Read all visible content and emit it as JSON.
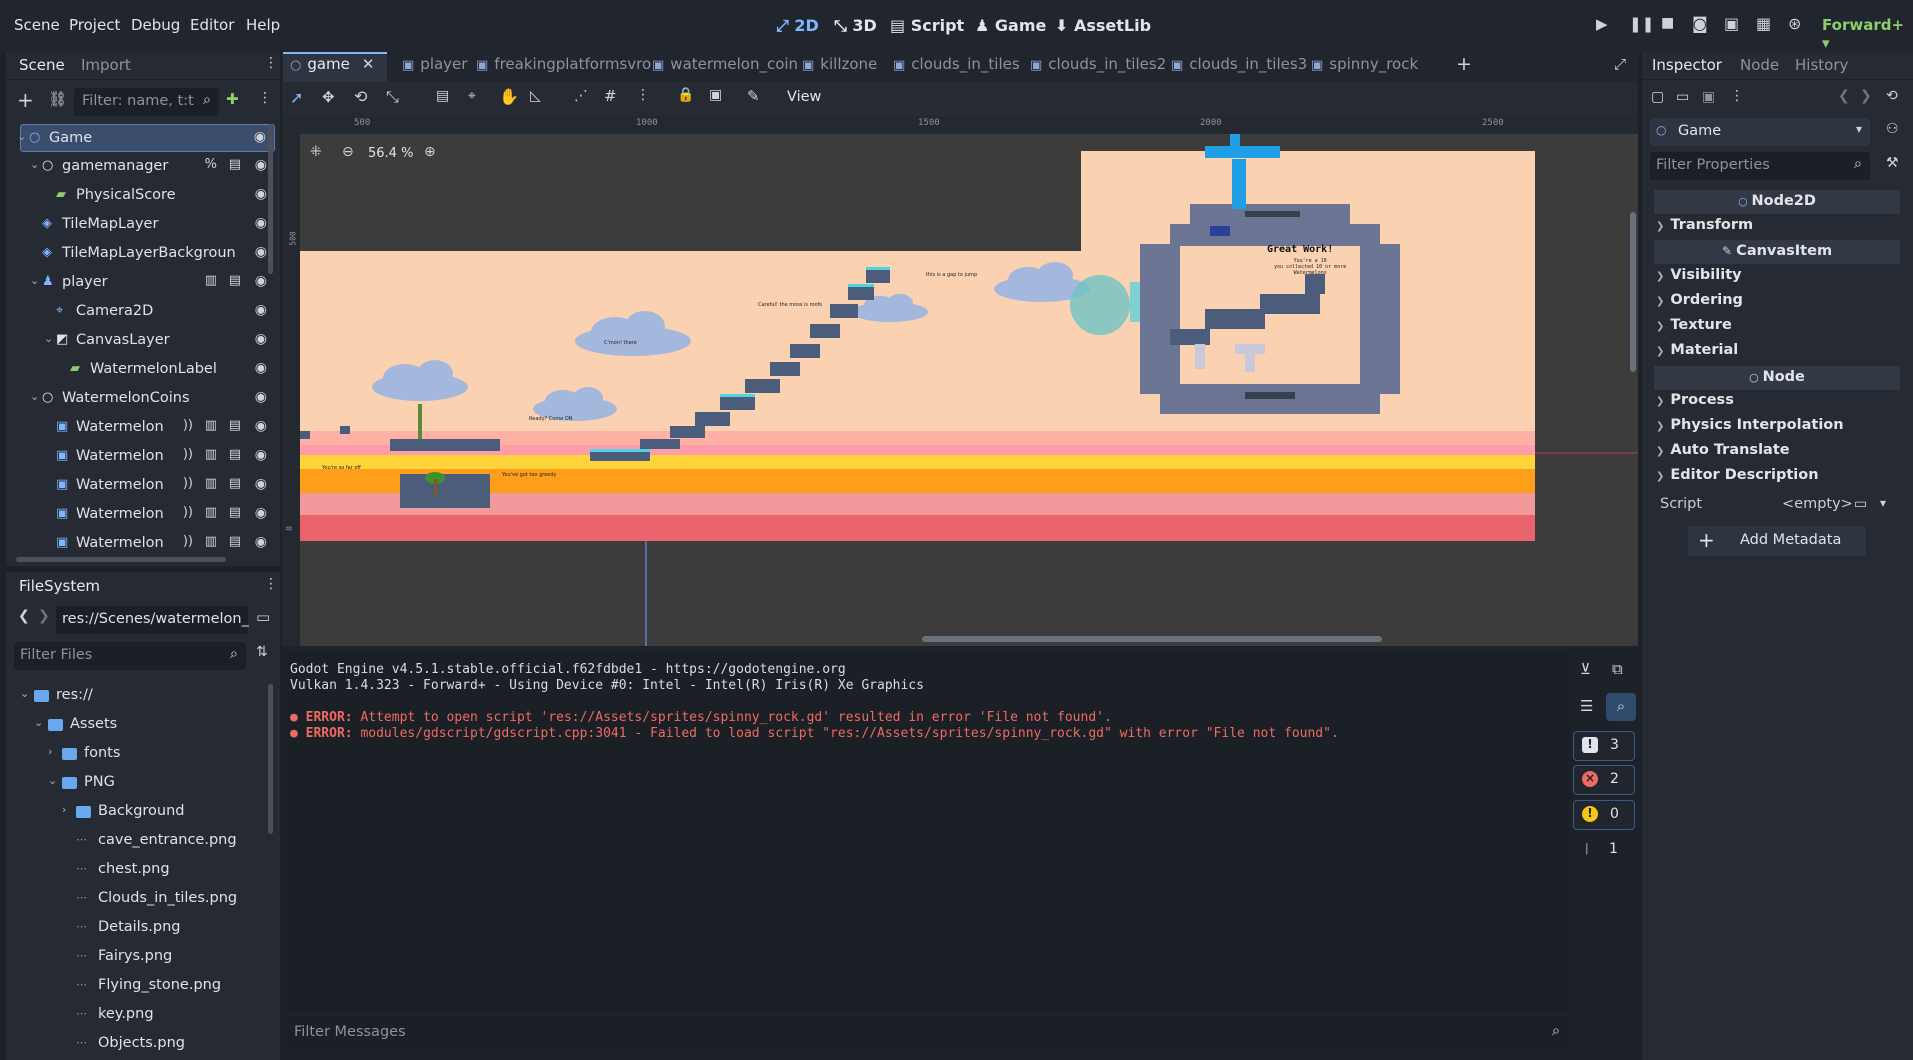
{
  "menu": [
    "Scene",
    "Project",
    "Debug",
    "Editor",
    "Help"
  ],
  "workspaces": [
    {
      "label": "2D",
      "icon": "2d-icon",
      "active": true
    },
    {
      "label": "3D",
      "icon": "3d-icon",
      "active": false
    },
    {
      "label": "Script",
      "icon": "script-icon",
      "active": false
    },
    {
      "label": "Game",
      "icon": "game-icon",
      "active": false
    },
    {
      "label": "AssetLib",
      "icon": "assetlib-icon",
      "active": false
    }
  ],
  "renderer": "Forward+",
  "scene_panel": {
    "tabs": [
      "Scene",
      "Import"
    ],
    "filter_placeholder": "Filter: name, t:t",
    "nodes": [
      {
        "label": "Game",
        "icon": "node2d-icon",
        "depth": 0,
        "expanded": true,
        "selected": true
      },
      {
        "label": "gamemanager",
        "icon": "node-icon",
        "depth": 1,
        "expanded": true,
        "extra": [
          "%",
          "script"
        ]
      },
      {
        "label": "PhysicalScore",
        "icon": "label-icon",
        "depth": 2
      },
      {
        "label": "TileMapLayer",
        "icon": "tilemap-icon",
        "depth": 1
      },
      {
        "label": "TileMapLayerBackgroun",
        "icon": "tilemap-icon",
        "depth": 1
      },
      {
        "label": "player",
        "icon": "player-icon",
        "depth": 1,
        "expanded": true,
        "extra": [
          "clapper",
          "script"
        ]
      },
      {
        "label": "Camera2D",
        "icon": "camera-icon",
        "depth": 2
      },
      {
        "label": "CanvasLayer",
        "icon": "canvaslayer-icon",
        "depth": 2,
        "expanded": true
      },
      {
        "label": "WatermelonLabel",
        "icon": "label-icon",
        "depth": 3
      },
      {
        "label": "WatermelonCoins",
        "icon": "node-icon",
        "depth": 1,
        "expanded": true
      },
      {
        "label": "Watermelon",
        "icon": "area-icon",
        "depth": 2,
        "extra": [
          "signal",
          "clapper",
          "script"
        ]
      },
      {
        "label": "Watermelon",
        "icon": "area-icon",
        "depth": 2,
        "extra": [
          "signal",
          "clapper",
          "script"
        ]
      },
      {
        "label": "Watermelon",
        "icon": "area-icon",
        "depth": 2,
        "extra": [
          "signal",
          "clapper",
          "script"
        ]
      },
      {
        "label": "Watermelon",
        "icon": "area-icon",
        "depth": 2,
        "extra": [
          "signal",
          "clapper",
          "script"
        ]
      },
      {
        "label": "Watermelon",
        "icon": "area-icon",
        "depth": 2,
        "extra": [
          "signal",
          "clapper",
          "script"
        ]
      }
    ]
  },
  "filesystem": {
    "title": "FileSystem",
    "path": "res://Scenes/watermelon_",
    "filter_placeholder": "Filter Files",
    "items": [
      {
        "label": "res://",
        "type": "folder",
        "depth": 0,
        "expanded": true
      },
      {
        "label": "Assets",
        "type": "folder",
        "depth": 1,
        "expanded": true
      },
      {
        "label": "fonts",
        "type": "folder",
        "depth": 2,
        "expanded": false
      },
      {
        "label": "PNG",
        "type": "folder",
        "depth": 2,
        "expanded": true
      },
      {
        "label": "Background",
        "type": "folder",
        "depth": 3,
        "expanded": false
      },
      {
        "label": "cave_entrance.png",
        "type": "file",
        "depth": 3
      },
      {
        "label": "chest.png",
        "type": "file",
        "depth": 3
      },
      {
        "label": "Clouds_in_tiles.png",
        "type": "file",
        "depth": 3
      },
      {
        "label": "Details.png",
        "type": "file",
        "depth": 3
      },
      {
        "label": "Fairys.png",
        "type": "file",
        "depth": 3
      },
      {
        "label": "Flying_stone.png",
        "type": "file",
        "depth": 3
      },
      {
        "label": "key.png",
        "type": "file",
        "depth": 3
      },
      {
        "label": "Objects.png",
        "type": "file",
        "depth": 3
      }
    ]
  },
  "editor_tabs": [
    {
      "label": "game",
      "active": true
    },
    {
      "label": "player"
    },
    {
      "label": "freakingplatformsvro"
    },
    {
      "label": "watermelon_coin"
    },
    {
      "label": "killzone"
    },
    {
      "label": "clouds_in_tiles"
    },
    {
      "label": "clouds_in_tiles2"
    },
    {
      "label": "clouds_in_tiles3"
    },
    {
      "label": "spinny_rock"
    }
  ],
  "toolbar": {
    "view_label": "View"
  },
  "viewport": {
    "zoom": "56.4 %",
    "ruler_h": [
      "500",
      "1000",
      "1500",
      "2000",
      "2500"
    ],
    "ruler_v": [
      "500",
      "0"
    ],
    "sign_great": "Great Work!",
    "sign_sub": "You're a 10\nyou collected 10 or more\nWatermelons",
    "sign_texts": [
      "Ready? Come ON",
      "C'mon! there",
      "Careful! the moss is roofs",
      "this is a gap to jump",
      "You're so far off",
      "You've got too greedy"
    ]
  },
  "inspector": {
    "tabs": [
      "Inspector",
      "Node",
      "History"
    ],
    "object": "Game",
    "filter_placeholder": "Filter Properties",
    "sections": [
      {
        "title": "Node2D",
        "groups": [
          "Transform"
        ]
      },
      {
        "title": "CanvasItem",
        "groups": [
          "Visibility",
          "Ordering",
          "Texture",
          "Material"
        ]
      },
      {
        "title": "Node",
        "groups": [
          "Process",
          "Physics Interpolation",
          "Auto Translate",
          "Editor Description"
        ]
      }
    ],
    "script_label": "Script",
    "script_value": "<empty>",
    "add_metadata": "Add Metadata"
  },
  "output": {
    "lines": [
      {
        "text": "Godot Engine v4.5.1.stable.official.f62fdbde1 - https://godotengine.org",
        "type": "info"
      },
      {
        "text": "Vulkan 1.4.323 - Forward+ - Using Device #0: Intel - Intel(R) Iris(R) Xe Graphics",
        "type": "info"
      },
      {
        "text": "",
        "type": "blank"
      },
      {
        "prefix": "ERROR:",
        "text": " Attempt to open script 'res://Assets/sprites/spinny_rock.gd' resulted in error 'File not found'.",
        "type": "error"
      },
      {
        "prefix": "ERROR:",
        "text": " modules/gdscript/gdscript.cpp:3041 - Failed to load script \"res://Assets/sprites/spinny_rock.gd\" with error \"File not found\".",
        "type": "error"
      }
    ],
    "filter_placeholder": "Filter Messages",
    "counts": {
      "messages": "3",
      "errors": "2",
      "warnings": "0",
      "editor": "1"
    }
  },
  "colors": {
    "accent": "#7fb6ff",
    "error": "#ef6a60",
    "warning": "#f5c518",
    "sky": "#fad2b2",
    "sand": "#ff9eaa",
    "band_yellow": "#ffd43b",
    "band_orange": "#ff9e1b"
  }
}
